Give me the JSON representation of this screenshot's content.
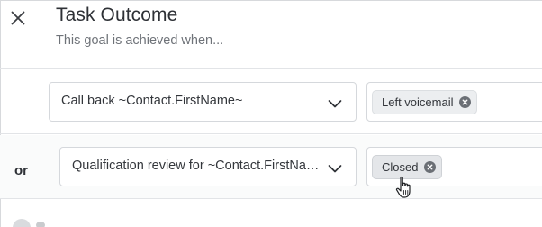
{
  "header": {
    "title": "Task Outcome",
    "subtitle": "This goal is achieved when..."
  },
  "conditions": [
    {
      "connector": "",
      "task": "Call back ~Contact.FirstName~",
      "outcome_tag": "Left voicemail"
    },
    {
      "connector": "or",
      "task": "Qualification review for ~Contact.FirstName~",
      "outcome_tag": "Closed"
    }
  ],
  "icons": {
    "close": "close-icon",
    "dropdown": "chevron-down-icon",
    "tag_remove": "remove-circle-icon",
    "cursor": "hand-pointer-cursor"
  },
  "colors": {
    "text_primary": "#2e3136",
    "text_secondary": "#6f7379",
    "border": "#d5d8dc",
    "tag_bg": "#eceef0",
    "tag_remove": "#6b6f75"
  }
}
